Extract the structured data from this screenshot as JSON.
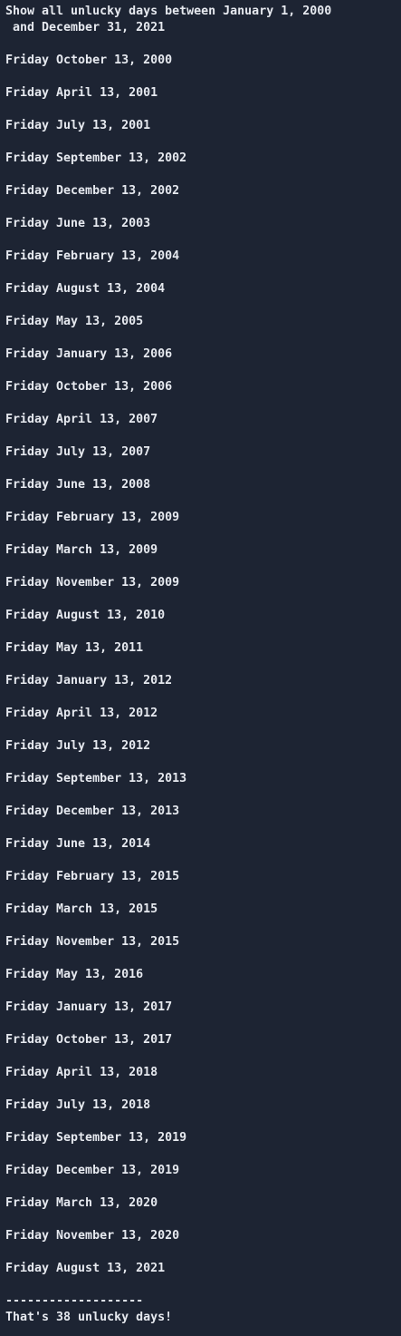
{
  "colors": {
    "background": "#1d2433",
    "text": "#e6e9ef"
  },
  "output": {
    "header_line1": "Show all unlucky days between January 1, 2000",
    "header_line2": " and December 31, 2021",
    "dates": [
      "Friday October 13, 2000",
      "Friday April 13, 2001",
      "Friday July 13, 2001",
      "Friday September 13, 2002",
      "Friday December 13, 2002",
      "Friday June 13, 2003",
      "Friday February 13, 2004",
      "Friday August 13, 2004",
      "Friday May 13, 2005",
      "Friday January 13, 2006",
      "Friday October 13, 2006",
      "Friday April 13, 2007",
      "Friday July 13, 2007",
      "Friday June 13, 2008",
      "Friday February 13, 2009",
      "Friday March 13, 2009",
      "Friday November 13, 2009",
      "Friday August 13, 2010",
      "Friday May 13, 2011",
      "Friday January 13, 2012",
      "Friday April 13, 2012",
      "Friday July 13, 2012",
      "Friday September 13, 2013",
      "Friday December 13, 2013",
      "Friday June 13, 2014",
      "Friday February 13, 2015",
      "Friday March 13, 2015",
      "Friday November 13, 2015",
      "Friday May 13, 2016",
      "Friday January 13, 2017",
      "Friday October 13, 2017",
      "Friday April 13, 2018",
      "Friday July 13, 2018",
      "Friday September 13, 2019",
      "Friday December 13, 2019",
      "Friday March 13, 2020",
      "Friday November 13, 2020",
      "Friday August 13, 2021"
    ],
    "separator": "-------------------",
    "summary": "That's 38 unlucky days!"
  }
}
